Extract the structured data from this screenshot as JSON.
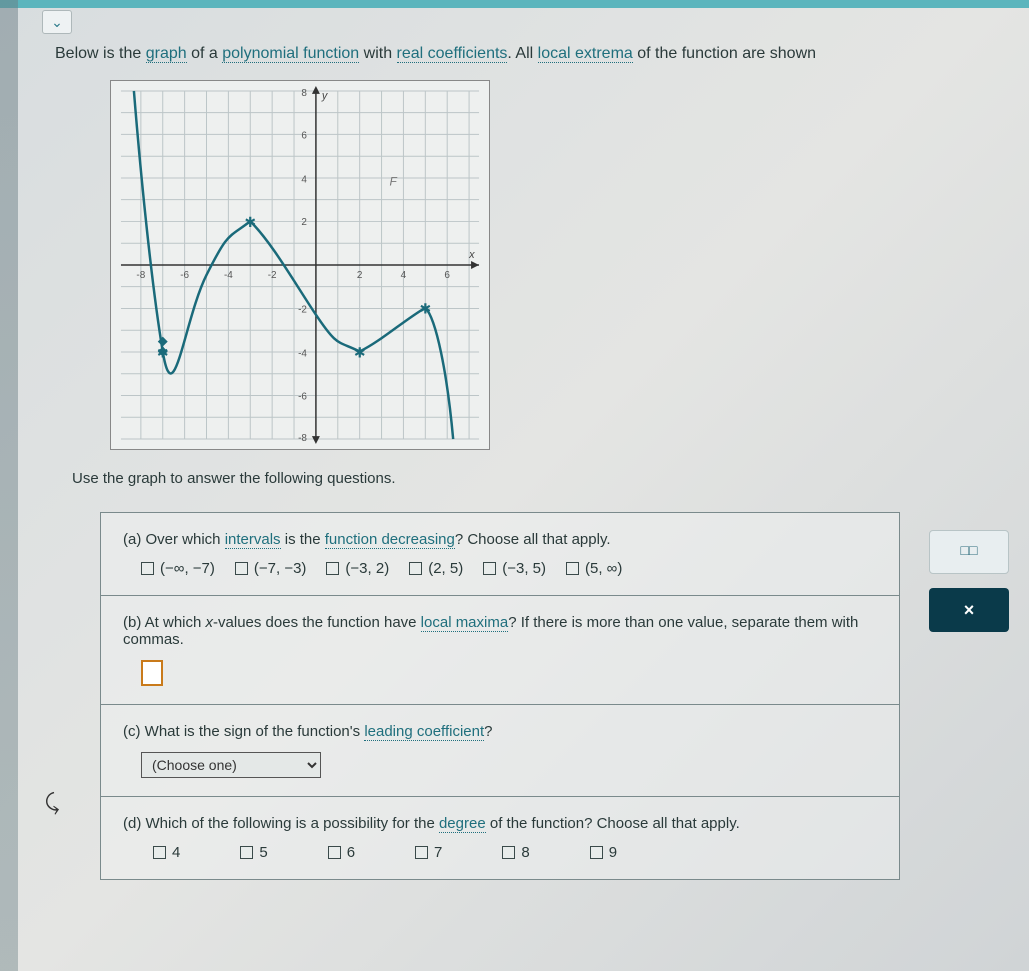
{
  "intro": {
    "t1": "Below is the ",
    "graph": "graph",
    "t2": " of a ",
    "poly": "polynomial function",
    "t3": " with ",
    "real": "real coefficients",
    "t4": ". All ",
    "extrema": "local extrema",
    "t5": " of the function are shown"
  },
  "use_graph": "Use the graph to answer the following questions.",
  "qa": {
    "t1": "(a) Over which ",
    "intervals": "intervals",
    "t2": " is the ",
    "fd": "function decreasing",
    "t3": "? Choose all that apply."
  },
  "a_opts": [
    "(−∞, −7)",
    "(−7, −3)",
    "(−3, 2)",
    "(2, 5)",
    "(−3, 5)",
    "(5, ∞)"
  ],
  "qb": {
    "t1": "(b) At which ",
    "xv": "x",
    "t2": "-values does the function have ",
    "lm": "local maxima",
    "t3": "? If there is more than one value, separate them with commas."
  },
  "qc": {
    "t1": "(c) What is the sign of the function's ",
    "lc": "leading coefficient",
    "t2": "?"
  },
  "qc_sel": "(Choose one)",
  "qd": {
    "t1": "(d) Which of the following is a possibility for the ",
    "deg": "degree",
    "t2": " of the function? Choose all that apply."
  },
  "d_opts": [
    "4",
    "5",
    "6",
    "7",
    "8",
    "9"
  ],
  "tools": {
    "interval": "□□",
    "close": "×"
  },
  "chart_data": {
    "type": "line",
    "title": "",
    "xlabel": "x",
    "ylabel": "y",
    "xlim": [
      -8,
      8
    ],
    "ylim": [
      -8,
      8
    ],
    "x_ticks": [
      -8,
      -6,
      -4,
      -2,
      2,
      4,
      6
    ],
    "y_ticks": [
      -8,
      -6,
      -4,
      -2,
      2,
      4,
      6,
      8
    ],
    "local_extrema": [
      {
        "x": -7,
        "y": -4,
        "type": "min"
      },
      {
        "x": -3,
        "y": 2,
        "type": "max"
      },
      {
        "x": 2,
        "y": -4,
        "type": "min"
      },
      {
        "x": 5,
        "y": -2,
        "type": "max"
      }
    ],
    "curve_points": [
      {
        "x": -8.3,
        "y": 8
      },
      {
        "x": -8,
        "y": 4
      },
      {
        "x": -7.5,
        "y": -1
      },
      {
        "x": -7,
        "y": -4
      },
      {
        "x": -6,
        "y": -2.5
      },
      {
        "x": -5,
        "y": -0.5
      },
      {
        "x": -4,
        "y": 1.2
      },
      {
        "x": -3,
        "y": 2
      },
      {
        "x": -2,
        "y": 1
      },
      {
        "x": -1,
        "y": -0.8
      },
      {
        "x": 0,
        "y": -2.3
      },
      {
        "x": 1,
        "y": -3.5
      },
      {
        "x": 2,
        "y": -4
      },
      {
        "x": 3,
        "y": -3.5
      },
      {
        "x": 4,
        "y": -2.6
      },
      {
        "x": 5,
        "y": -2
      },
      {
        "x": 5.5,
        "y": -2.5
      },
      {
        "x": 6,
        "y": -5
      },
      {
        "x": 6.3,
        "y": -8
      }
    ]
  }
}
